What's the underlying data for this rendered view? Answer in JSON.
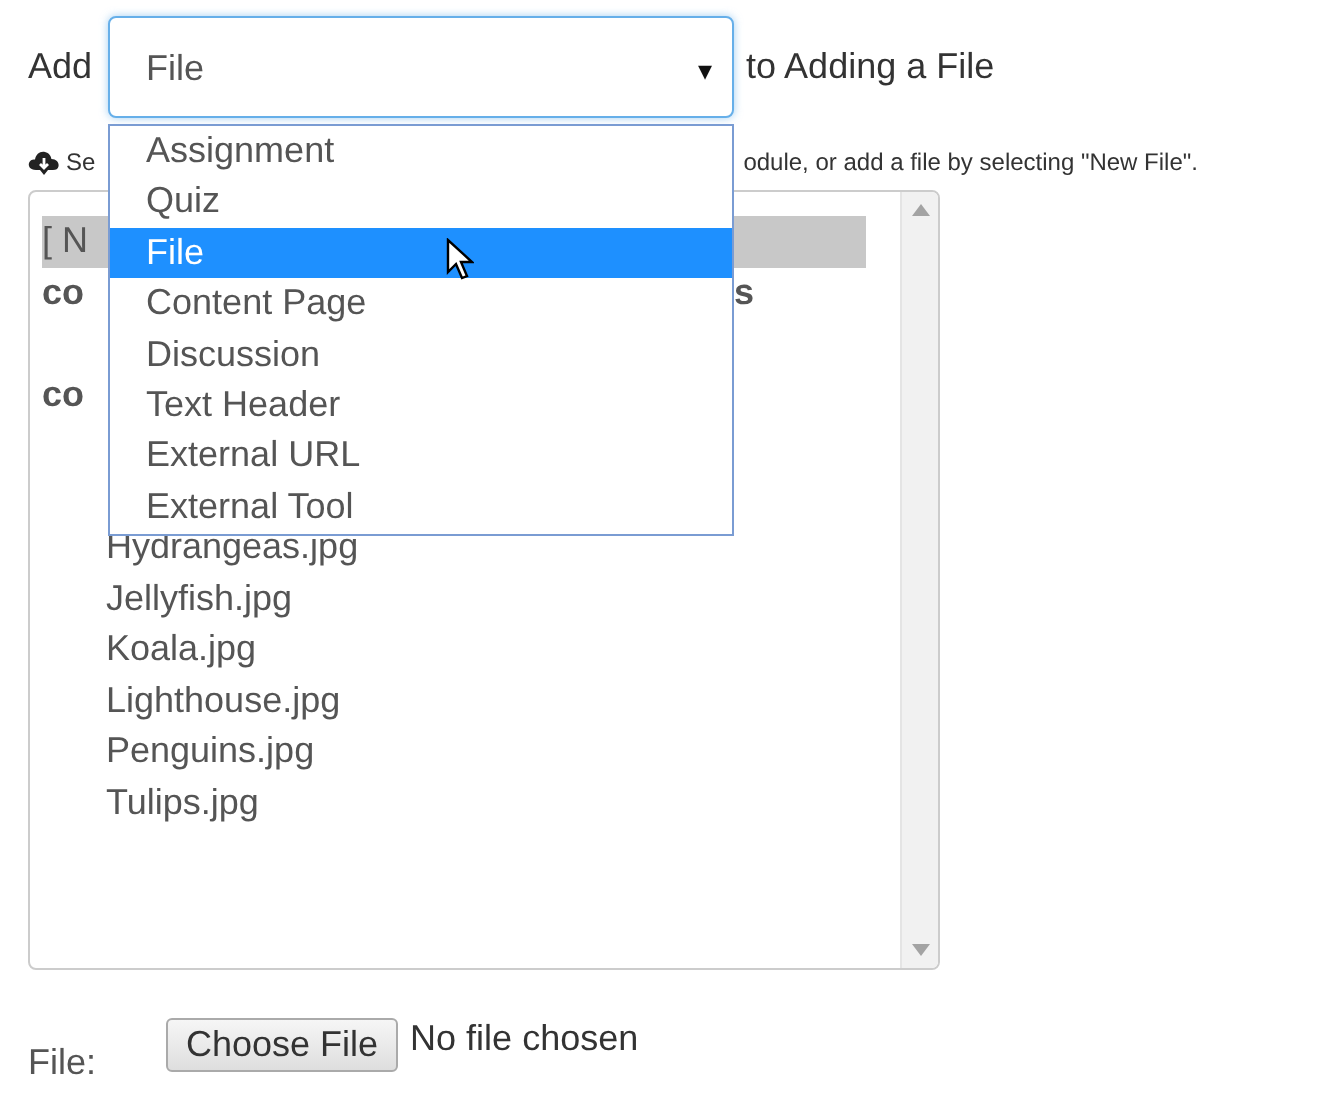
{
  "add_row": {
    "prefix": "Add",
    "select_value": "File",
    "arrow": "▾",
    "suffix": "to Adding a File"
  },
  "dropdown": [
    {
      "label": "Assignment",
      "selected": false
    },
    {
      "label": "Quiz",
      "selected": false
    },
    {
      "label": "File",
      "selected": true
    },
    {
      "label": "Content Page",
      "selected": false
    },
    {
      "label": "Discussion",
      "selected": false
    },
    {
      "label": "Text Header",
      "selected": false
    },
    {
      "label": "External URL",
      "selected": false
    },
    {
      "label": "External Tool",
      "selected": false
    }
  ],
  "hint": {
    "start": "Se",
    "end": "odule, or add a file by selecting \"New File\"."
  },
  "file_list": [
    {
      "kind": "option",
      "text": "[ N",
      "selected": true
    },
    {
      "kind": "folder",
      "text": "co",
      "tail": "s",
      "selected": false
    },
    {
      "kind": "folder",
      "text": "co",
      "selected": false,
      "children": [
        {
          "kind": "file",
          "text": "Hydrangeas.jpg",
          "selected": false
        },
        {
          "kind": "file",
          "text": "Jellyfish.jpg",
          "selected": false
        },
        {
          "kind": "file",
          "text": "Koala.jpg",
          "selected": false
        },
        {
          "kind": "file",
          "text": "Lighthouse.jpg",
          "selected": false
        },
        {
          "kind": "file",
          "text": "Penguins.jpg",
          "selected": false
        },
        {
          "kind": "file",
          "text": "Tulips.jpg",
          "selected": false
        }
      ]
    }
  ],
  "file_field": {
    "label": "File:",
    "button": "Choose File",
    "status": "No file chosen"
  }
}
